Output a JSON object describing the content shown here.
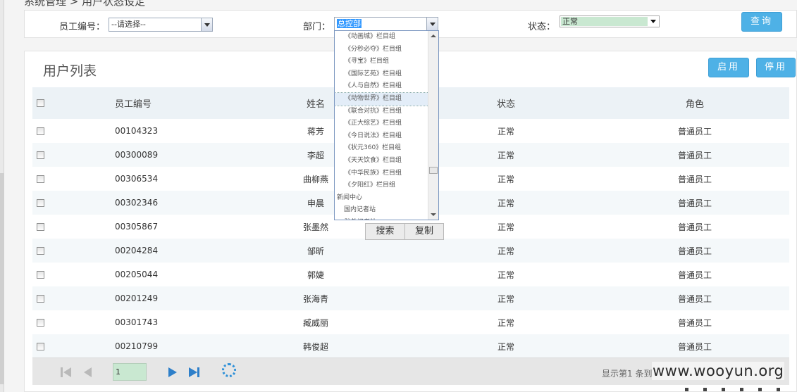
{
  "top_truncated_text": "系统管理 > 用户状态设定",
  "filters": {
    "employee_id_label": "员工编号：",
    "employee_id_selected": "--请选择--",
    "dept_label": "部门：",
    "dept_value": "总控部",
    "status_label": "状态：",
    "status_selected": "正常",
    "query_button": "查询"
  },
  "dept_dropdown": {
    "items": [
      {
        "label": "《动画城》栏目组",
        "level": 2
      },
      {
        "label": "《分秒必夺》栏目组",
        "level": 2
      },
      {
        "label": "《寻宝》栏目组",
        "level": 2
      },
      {
        "label": "《国际艺苑》栏目组",
        "level": 2
      },
      {
        "label": "《人与自然》栏目组",
        "level": 2
      },
      {
        "label": "《动物世界》栏目组",
        "level": 2
      },
      {
        "label": "《联合对抗》栏目组",
        "level": 2
      },
      {
        "label": "《正大综艺》栏目组",
        "level": 2
      },
      {
        "label": "《今日说法》栏目组",
        "level": 2
      },
      {
        "label": "《状元360》栏目组",
        "level": 2
      },
      {
        "label": "《天天饮食》栏目组",
        "level": 2
      },
      {
        "label": "《中华民族》栏目组",
        "level": 2
      },
      {
        "label": "《夕阳红》栏目组",
        "level": 2
      },
      {
        "label": "新闻中心",
        "level": 0
      },
      {
        "label": "国内记者站",
        "level": 1
      },
      {
        "label": "驻外记者站",
        "level": 2
      }
    ],
    "highlighted_index": 5
  },
  "dropdown_buttons": {
    "search": "搜索",
    "copy": "复制"
  },
  "panel": {
    "title": "用户列表",
    "enable_button": "启用",
    "disable_button": "停用"
  },
  "table": {
    "columns": [
      "员工编号",
      "姓名",
      "状态",
      "角色"
    ],
    "rows": [
      {
        "id": "00104323",
        "name": "蒋芳",
        "status": "正常",
        "role": "普通员工"
      },
      {
        "id": "00300089",
        "name": "李超",
        "status": "正常",
        "role": "普通员工"
      },
      {
        "id": "00306534",
        "name": "曲柳燕",
        "status": "正常",
        "role": "普通员工"
      },
      {
        "id": "00302346",
        "name": "申晨",
        "status": "正常",
        "role": "普通员工"
      },
      {
        "id": "00305867",
        "name": "张墨然",
        "status": "正常",
        "role": "普通员工"
      },
      {
        "id": "00204284",
        "name": "邹昕",
        "status": "正常",
        "role": "普通员工"
      },
      {
        "id": "00205044",
        "name": "郭婕",
        "status": "正常",
        "role": "普通员工"
      },
      {
        "id": "00201249",
        "name": "张海青",
        "status": "正常",
        "role": "普通员工"
      },
      {
        "id": "00301743",
        "name": "臧威丽",
        "status": "正常",
        "role": "普通员工"
      },
      {
        "id": "00210799",
        "name": "韩俊超",
        "status": "正常",
        "role": "普通员工"
      }
    ]
  },
  "pager": {
    "page": "1",
    "info": "显示第1 条到"
  },
  "watermark": "www.wooyun.org"
}
